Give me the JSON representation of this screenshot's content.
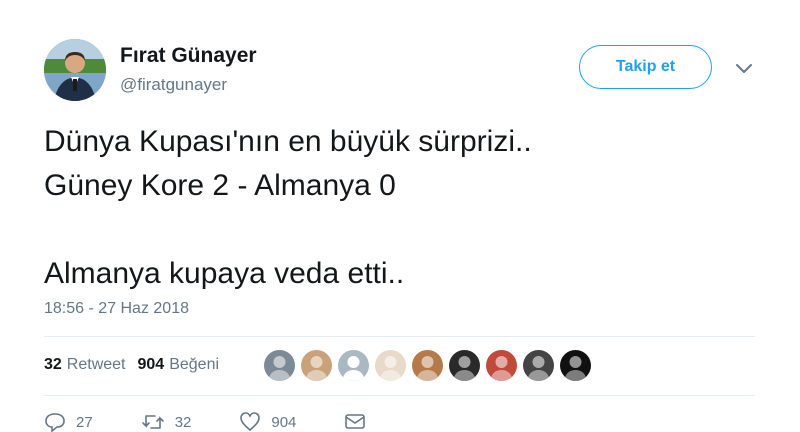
{
  "author": {
    "name": "Fırat Günayer",
    "handle": "@firatgunayer"
  },
  "follow_button": {
    "label": "Takip et"
  },
  "tweet": {
    "text": "Dünya Kupası'nın en büyük sürprizi..\nGüney Kore 2 - Almanya 0\n\nAlmanya kupaya veda etti..",
    "timestamp": "18:56 - 27 Haz 2018"
  },
  "stats": {
    "retweets_count": "32",
    "retweets_label": "Retweet",
    "likes_count": "904",
    "likes_label": "Beğeni"
  },
  "liker_avatars": [
    {
      "color": "#7c8a96"
    },
    {
      "color": "#c9a27a"
    },
    {
      "color": "#aab8c2"
    },
    {
      "color": "#e8d9c8"
    },
    {
      "color": "#b57a4a"
    },
    {
      "color": "#2a2a2a"
    },
    {
      "color": "#c24a3b"
    },
    {
      "color": "#444444"
    },
    {
      "color": "#111111"
    }
  ],
  "actions": {
    "reply_count": "27",
    "retweet_count": "32",
    "like_count": "904"
  },
  "colors": {
    "accent": "#1da1f2",
    "secondary_text": "#657786",
    "divider": "#e6ecf0"
  }
}
